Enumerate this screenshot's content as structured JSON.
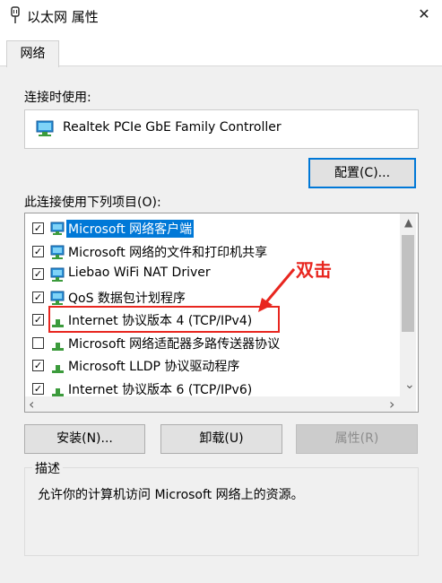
{
  "window": {
    "title": "以太网 属性",
    "close_glyph": "✕"
  },
  "tabs": [
    {
      "label": "网络"
    }
  ],
  "connect_using": {
    "label": "连接时使用:",
    "adapter_name": "Realtek PCIe GbE Family Controller",
    "configure_button": "配置(C)..."
  },
  "items_section": {
    "label": "此连接使用下列项目(O):",
    "items": [
      {
        "label": "Microsoft 网络客户端",
        "checked": true,
        "selected": true,
        "icon": "network-client-icon"
      },
      {
        "label": "Microsoft 网络的文件和打印机共享",
        "checked": true,
        "selected": false,
        "icon": "network-service-icon"
      },
      {
        "label": "Liebao WiFi NAT Driver",
        "checked": true,
        "selected": false,
        "icon": "network-service-icon"
      },
      {
        "label": "QoS 数据包计划程序",
        "checked": true,
        "selected": false,
        "icon": "network-service-icon"
      },
      {
        "label": "Internet 协议版本 4 (TCP/IPv4)",
        "checked": true,
        "selected": false,
        "icon": "protocol-icon"
      },
      {
        "label": "Microsoft 网络适配器多路传送器协议",
        "checked": false,
        "selected": false,
        "icon": "protocol-icon"
      },
      {
        "label": "Microsoft LLDP 协议驱动程序",
        "checked": true,
        "selected": false,
        "icon": "protocol-icon"
      },
      {
        "label": "Internet 协议版本 6 (TCP/IPv6)",
        "checked": true,
        "selected": false,
        "icon": "protocol-icon"
      }
    ],
    "check_glyph": "✓"
  },
  "scrollbar": {
    "up": "▲",
    "down": "⌄",
    "left": "‹",
    "right": "›"
  },
  "buttons": {
    "install": "安装(N)...",
    "uninstall": "卸载(U)",
    "properties": "属性(R)"
  },
  "description": {
    "legend": "描述",
    "text": "允许你的计算机访问 Microsoft 网络上的资源。"
  },
  "annotation": {
    "text": "双击",
    "color": "#e8261f"
  },
  "colors": {
    "accent": "#0078d7",
    "panel": "#f0f0f0"
  }
}
